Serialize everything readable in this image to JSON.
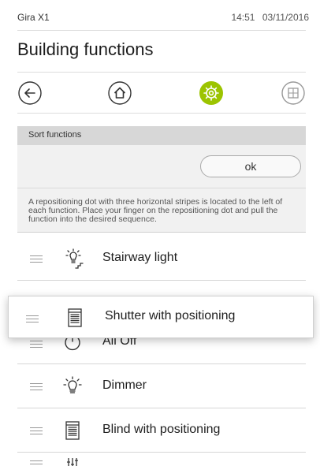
{
  "status_bar": {
    "device_name": "Gira X1",
    "time": "14:51",
    "date": "03/11/2016"
  },
  "page": {
    "title": "Building functions"
  },
  "nav": {
    "icons": [
      "back-arrow-icon",
      "home-icon",
      "settings-gear-icon",
      "grid-icon"
    ],
    "accent_color": "#9cc400"
  },
  "sort": {
    "header_label": "Sort functions",
    "ok_label": "ok",
    "instructions": "A repositioning dot with three horizontal stripes is located to the left of each function. Place your finger on the repositioning dot and pull the function into the desired sequence."
  },
  "functions": [
    {
      "label": "Stairway light",
      "icon": "stairway-light-icon"
    },
    {
      "label": "Shutter with positioning",
      "icon": "shutter-icon",
      "state": "dragging"
    },
    {
      "label": "All Off",
      "icon": "power-icon"
    },
    {
      "label": "Dimmer",
      "icon": "dimmer-bulb-icon"
    },
    {
      "label": "Blind with positioning",
      "icon": "blind-icon"
    },
    {
      "label": "",
      "icon": "partial-function-icon"
    }
  ]
}
